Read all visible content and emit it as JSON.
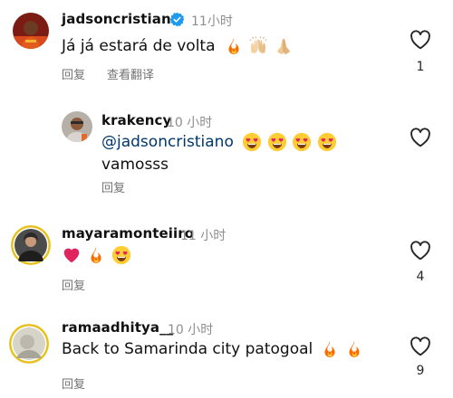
{
  "comments": [
    {
      "username": "jadsoncristiano",
      "verified": true,
      "time": "11小时",
      "text": "Já já estará de volta",
      "emojis": [
        "fire",
        "raising-hands",
        "folded-hands"
      ],
      "actions": [
        "回复",
        "查看翻译"
      ],
      "likes": "1"
    },
    {
      "username": "krakency",
      "time": "10 小时",
      "mention": "@jadsoncristiano",
      "emojis": [
        "heart-eyes",
        "heart-eyes",
        "heart-eyes",
        "heart-eyes"
      ],
      "text2": "vamosss",
      "actions": [
        "回复"
      ],
      "likes": ""
    },
    {
      "username": "mayaramonteiiro",
      "time": "11 小时",
      "emojis": [
        "red-heart",
        "fire",
        "heart-eyes"
      ],
      "actions": [
        "回复"
      ],
      "likes": "4"
    },
    {
      "username": "ramaadhitya__",
      "time": "10 小时",
      "text": "Back to Samarinda city patogoal",
      "emojis": [
        "fire",
        "fire"
      ],
      "actions": [
        "回复"
      ],
      "likes": "9"
    }
  ],
  "colors": {
    "fire": "#ff6a00",
    "heart_red": "#e0245e",
    "verified_blue": "#1d9bf0",
    "mention_blue": "#00376b",
    "muted_gray": "#737373"
  }
}
